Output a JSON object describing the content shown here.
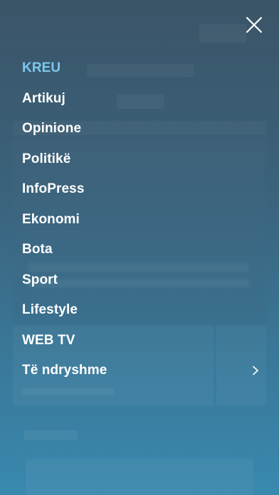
{
  "colors": {
    "active": "#7cc7ee",
    "text": "#ffffff",
    "background": "#3b6f8d"
  },
  "close_icon": "close-icon",
  "menu": {
    "items": [
      {
        "label": "KREU",
        "active": true
      },
      {
        "label": "Artikuj"
      },
      {
        "label": "Opinione"
      },
      {
        "label": "Politikë"
      },
      {
        "label": "InfoPress"
      },
      {
        "label": "Ekonomi"
      },
      {
        "label": "Bota"
      },
      {
        "label": "Sport"
      },
      {
        "label": "Lifestyle"
      },
      {
        "label": "WEB TV"
      },
      {
        "label": "Të ndryshme",
        "has_submenu": true,
        "icon": "chevron-right-icon"
      }
    ]
  }
}
